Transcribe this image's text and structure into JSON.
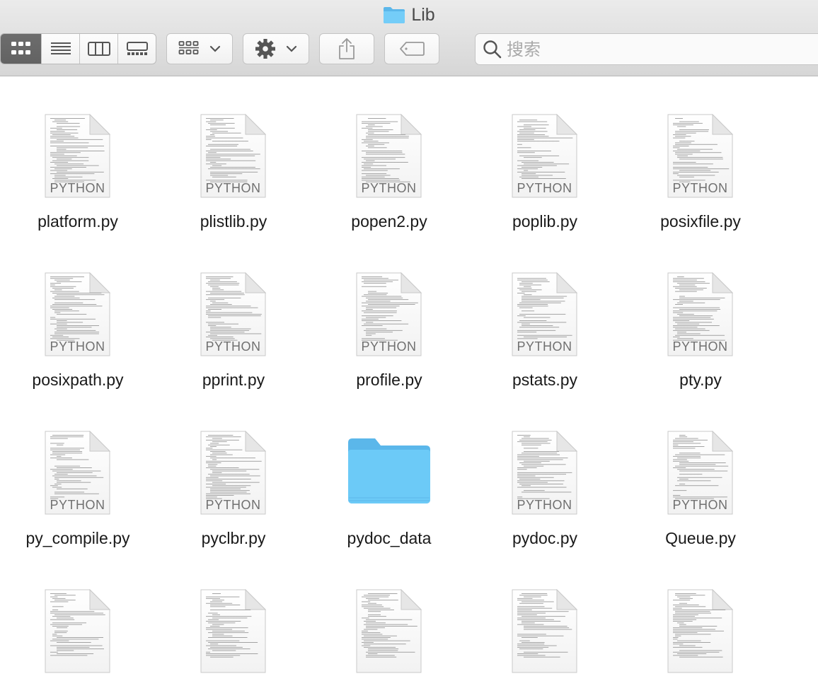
{
  "window": {
    "title": "Lib"
  },
  "toolbar": {
    "view_modes": [
      {
        "name": "icon-view",
        "active": true
      },
      {
        "name": "list-view",
        "active": false
      },
      {
        "name": "column-view",
        "active": false
      },
      {
        "name": "gallery-view",
        "active": false
      }
    ],
    "group_icon": "grid-icon",
    "action_icon": "gear-icon",
    "share_icon": "share-icon",
    "tag_icon": "tag-icon"
  },
  "search": {
    "placeholder": "搜索",
    "value": ""
  },
  "doc_badge": "PYTHON",
  "files": [
    {
      "name": "platform.py",
      "kind": "python"
    },
    {
      "name": "plistlib.py",
      "kind": "python"
    },
    {
      "name": "popen2.py",
      "kind": "python"
    },
    {
      "name": "poplib.py",
      "kind": "python"
    },
    {
      "name": "posixfile.py",
      "kind": "python"
    },
    {
      "name": "posixpath.py",
      "kind": "python"
    },
    {
      "name": "pprint.py",
      "kind": "python"
    },
    {
      "name": "profile.py",
      "kind": "python"
    },
    {
      "name": "pstats.py",
      "kind": "python"
    },
    {
      "name": "pty.py",
      "kind": "python"
    },
    {
      "name": "py_compile.py",
      "kind": "python"
    },
    {
      "name": "pyclbr.py",
      "kind": "python"
    },
    {
      "name": "pydoc_data",
      "kind": "folder"
    },
    {
      "name": "pydoc.py",
      "kind": "python"
    },
    {
      "name": "Queue.py",
      "kind": "python"
    }
  ],
  "partial_row_kinds": [
    "python",
    "python",
    "python",
    "python",
    "python"
  ],
  "colors": {
    "folder": "#6ccaf7",
    "folder_dark": "#5bb7ea",
    "active_segment": "#666666"
  }
}
